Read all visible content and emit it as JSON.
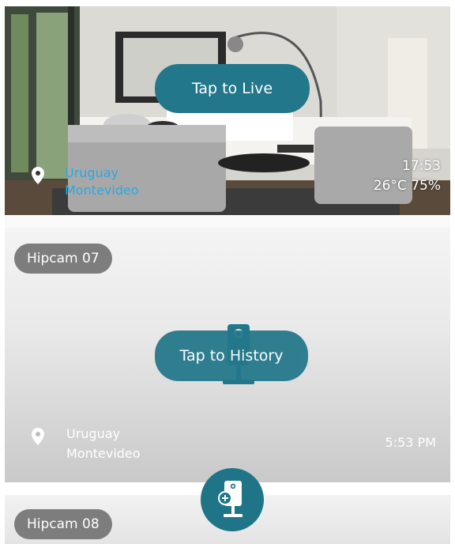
{
  "live_card": {
    "button_label": "Tap to Live",
    "location_country": "Uruguay",
    "location_city": "Montevideo",
    "time": "17:53",
    "climate": "26°C 75%"
  },
  "cameras": [
    {
      "name": "Hipcam 07",
      "button_label": "Tap to History",
      "location_country": "Uruguay",
      "location_city": "Montevideo",
      "time": "5:53 PM"
    },
    {
      "name": "Hipcam 08"
    }
  ],
  "icons": {
    "location": "location-pin-icon",
    "add_camera": "add-camera-icon",
    "camera_placeholder": "camera-icon"
  },
  "colors": {
    "accent": "#22778a",
    "badge": "#7d7d7d",
    "location_text_live": "#2aa8e0"
  }
}
